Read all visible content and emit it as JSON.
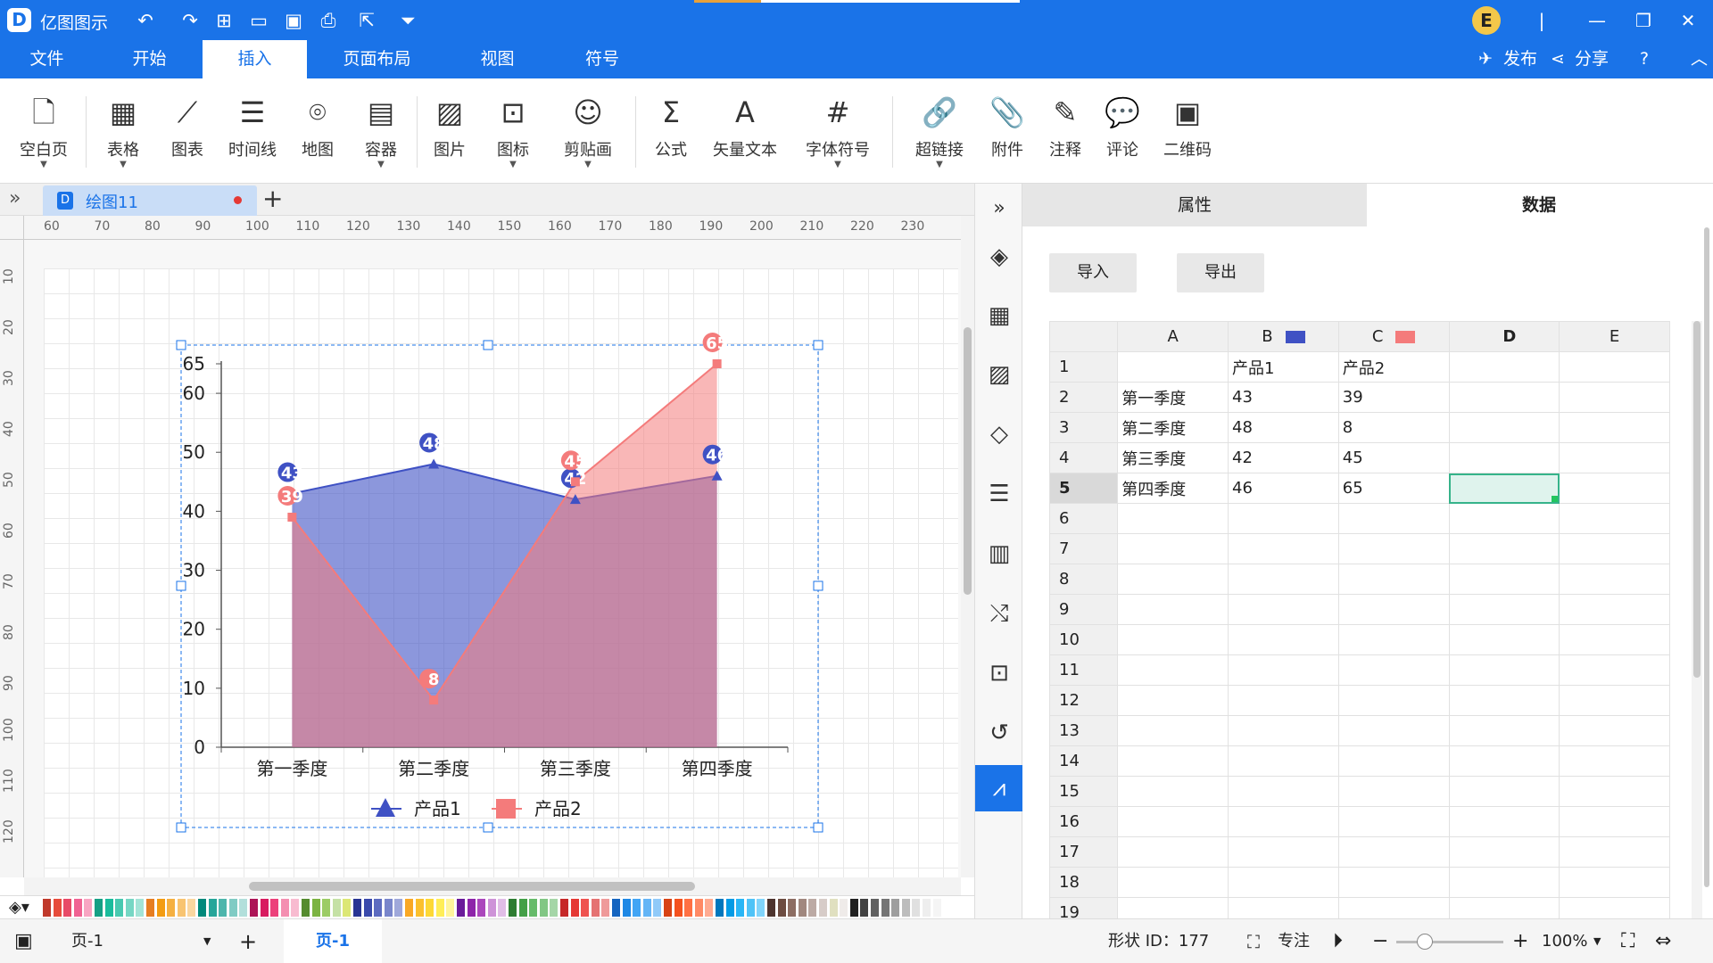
{
  "app": {
    "name": "亿图图示",
    "logo_glyph": "D",
    "avatar_letter": "E"
  },
  "menu": {
    "tabs": [
      "文件",
      "开始",
      "插入",
      "页面布局",
      "视图",
      "符号"
    ],
    "active": "插入",
    "publish": "发布",
    "share": "分享",
    "help": "?"
  },
  "ribbon": {
    "items": [
      {
        "label": "空白页",
        "icon": "blank-page-icon",
        "glyph": "🗋"
      },
      {
        "label": "表格",
        "icon": "table-icon",
        "glyph": "▦"
      },
      {
        "label": "图表",
        "icon": "chart-icon",
        "glyph": "⟋"
      },
      {
        "label": "时间线",
        "icon": "timeline-icon",
        "glyph": "☰"
      },
      {
        "label": "地图",
        "icon": "map-icon",
        "glyph": "⌾"
      },
      {
        "label": "容器",
        "icon": "container-icon",
        "glyph": "▤"
      },
      {
        "label": "图片",
        "icon": "image-icon",
        "glyph": "▨"
      },
      {
        "label": "图标",
        "icon": "icon-icon",
        "glyph": "⊡"
      },
      {
        "label": "剪贴画",
        "icon": "clipart-icon",
        "glyph": "☺"
      },
      {
        "label": "公式",
        "icon": "formula-icon",
        "glyph": "Σ"
      },
      {
        "label": "矢量文本",
        "icon": "vector-text-icon",
        "glyph": "A"
      },
      {
        "label": "字体符号",
        "icon": "font-symbol-icon",
        "glyph": "#"
      },
      {
        "label": "超链接",
        "icon": "hyperlink-icon",
        "glyph": "🔗"
      },
      {
        "label": "附件",
        "icon": "attachment-icon",
        "glyph": "📎"
      },
      {
        "label": "注释",
        "icon": "annotation-icon",
        "glyph": "✎"
      },
      {
        "label": "评论",
        "icon": "comment-icon",
        "glyph": "💬"
      },
      {
        "label": "二维码",
        "icon": "qrcode-icon",
        "glyph": "▣"
      }
    ]
  },
  "document": {
    "tab_title": "绘图11"
  },
  "ruler": {
    "h": [
      "60",
      "70",
      "80",
      "90",
      "100",
      "110",
      "120",
      "130",
      "140",
      "150",
      "160",
      "170",
      "180",
      "190",
      "200",
      "210",
      "220",
      "230"
    ],
    "v": [
      "10",
      "20",
      "30",
      "40",
      "50",
      "60",
      "70",
      "80",
      "90",
      "100",
      "110",
      "120"
    ]
  },
  "chart_data": {
    "type": "area",
    "categories": [
      "第一季度",
      "第二季度",
      "第三季度",
      "第四季度"
    ],
    "series": [
      {
        "name": "产品1",
        "values": [
          43,
          48,
          42,
          46
        ],
        "color": "#3f51c4",
        "marker": "triangle"
      },
      {
        "name": "产品2",
        "values": [
          39,
          8,
          45,
          65
        ],
        "color": "#f47b7b",
        "marker": "square"
      }
    ],
    "yticks": [
      "0",
      "10",
      "20",
      "30",
      "40",
      "50",
      "60",
      "65"
    ],
    "ylim": [
      0,
      65
    ],
    "legend": "bottom"
  },
  "side_panel": {
    "tabs": [
      "属性",
      "数据"
    ],
    "active_tab": "数据",
    "buttons": {
      "import": "导入",
      "export": "导出"
    },
    "columns": [
      "A",
      "B",
      "C",
      "D",
      "E"
    ],
    "rows": [
      [
        "",
        "产品1",
        "产品2",
        "",
        ""
      ],
      [
        "第一季度",
        "43",
        "39",
        "",
        ""
      ],
      [
        "第二季度",
        "48",
        "8",
        "",
        ""
      ],
      [
        "第三季度",
        "42",
        "45",
        "",
        ""
      ],
      [
        "第四季度",
        "46",
        "65",
        "",
        ""
      ]
    ],
    "row_numbers": [
      "1",
      "2",
      "3",
      "4",
      "5",
      "6",
      "7",
      "8",
      "9",
      "10",
      "11",
      "12",
      "13",
      "14",
      "15",
      "16",
      "17",
      "18",
      "19"
    ],
    "selected_row": "5",
    "selected_col": "D",
    "col_colors": {
      "B": "#3f51c4",
      "C": "#f47b7b"
    }
  },
  "status": {
    "page_select": "页-1",
    "add": "+",
    "active_page": "页-1",
    "shape_id": "形状 ID：177",
    "focus": "专注",
    "zoom": "100%"
  },
  "palette_colors": [
    "#c0392b",
    "#e74c3c",
    "#e84a67",
    "#f06292",
    "#f8a5c2",
    "#16a085",
    "#1abc9c",
    "#48c9b0",
    "#76d7c4",
    "#a3e4d7",
    "#e67e22",
    "#f39c12",
    "#f5b041",
    "#f8c471",
    "#fad7a0",
    "#00897b",
    "#26a69a",
    "#4db6ac",
    "#80cbc4",
    "#b2dfdb",
    "#ad1457",
    "#d81b60",
    "#ec407a",
    "#f48fb1",
    "#f8bbd0",
    "#558b2f",
    "#7cb342",
    "#9ccc65",
    "#c5e1a5",
    "#dce775",
    "#283593",
    "#3949ab",
    "#5c6bc0",
    "#7986cb",
    "#9fa8da",
    "#f9a825",
    "#fbc02d",
    "#fdd835",
    "#ffee58",
    "#fff59d",
    "#6a1b9a",
    "#8e24aa",
    "#ab47bc",
    "#ce93d8",
    "#e1bee7",
    "#2e7d32",
    "#43a047",
    "#66bb6a",
    "#81c784",
    "#a5d6a7",
    "#c62828",
    "#e53935",
    "#ef5350",
    "#e57373",
    "#ef9a9a",
    "#1565c0",
    "#1e88e5",
    "#42a5f5",
    "#64b5f6",
    "#90caf9",
    "#d84315",
    "#f4511e",
    "#ff7043",
    "#ff8a65",
    "#ffab91",
    "#0277bd",
    "#039be5",
    "#29b6f6",
    "#4fc3f7",
    "#81d4fa",
    "#4e342e",
    "#6d4c41",
    "#8d6e63",
    "#a1887f",
    "#bcaaa4",
    "#d7ccc8",
    "#e0e0c0",
    "#efebe9",
    "#212121",
    "#424242",
    "#616161",
    "#757575",
    "#9e9e9e",
    "#bdbdbd",
    "#e0e0e0",
    "#eeeeee",
    "#f5f5f5"
  ]
}
